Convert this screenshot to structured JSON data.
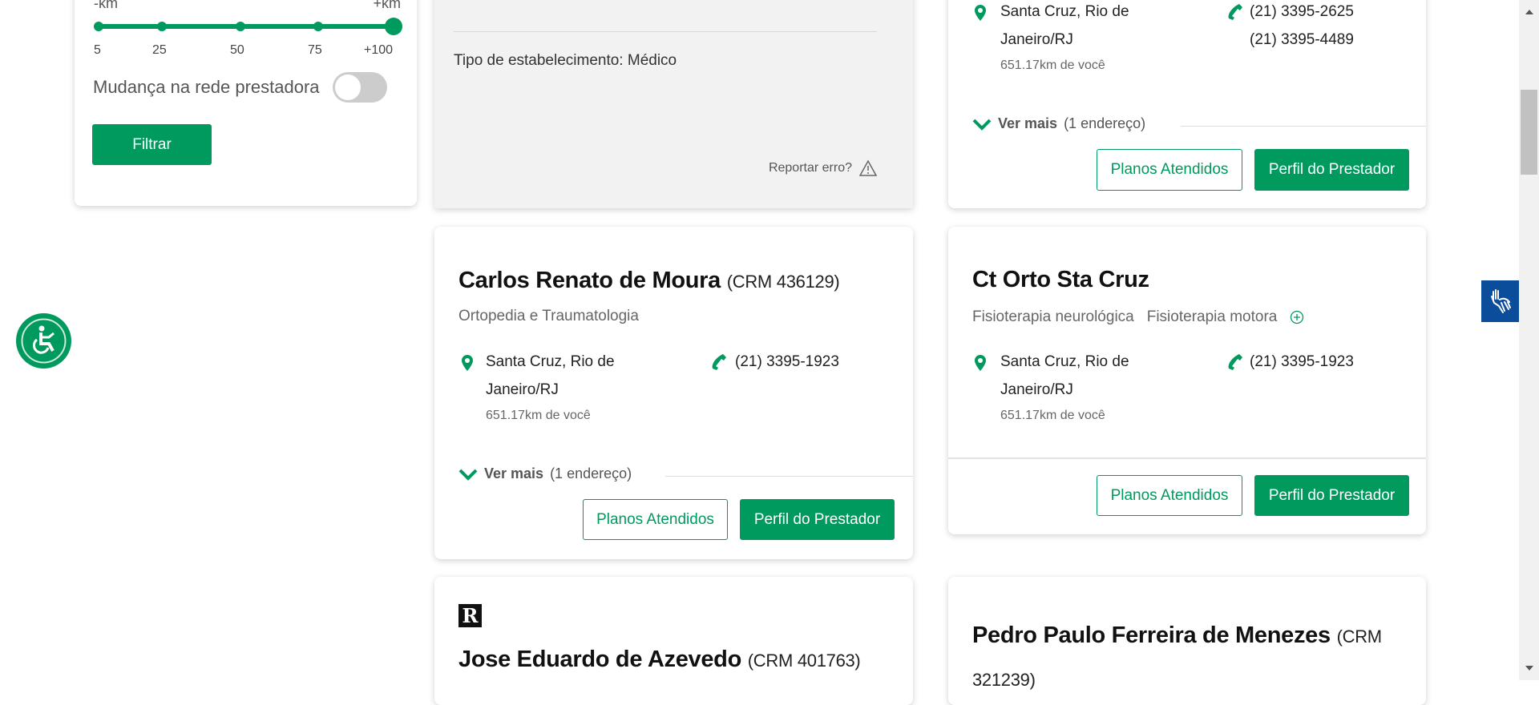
{
  "filter": {
    "min_label": "-km",
    "max_label": "+km",
    "ticks": [
      "5",
      "25",
      "50",
      "75",
      "+100"
    ],
    "selected_tick": "+100",
    "toggle_label": "Mudança na rede prestadora",
    "toggle_on": false,
    "filter_button": "Filtrar"
  },
  "top_left_card": {
    "type_text": "Tipo de estabelecimento: Médico",
    "report": "Reportar erro?"
  },
  "top_right_card": {
    "address_line1": "Santa Cruz, Rio de",
    "address_line2": "Janeiro/RJ",
    "distance": "651.17km de você",
    "phones": [
      "(21) 3395-2625",
      "(21) 3395-4489"
    ],
    "ver_mais": "Ver mais",
    "ver_mais_count": "(1 endereço)"
  },
  "cards": [
    {
      "name": "Carlos Renato de Moura",
      "crm": "(CRM 436129)",
      "specialties": [
        "Ortopedia e Traumatologia"
      ],
      "address_line1": "Santa Cruz, Rio de",
      "address_line2": "Janeiro/RJ",
      "distance": "651.17km de você",
      "phone": "(21) 3395-1923",
      "ver_mais": "Ver mais",
      "ver_mais_count": "(1 endereço)"
    },
    {
      "name": "Ct Orto Sta Cruz",
      "crm": "",
      "specialties": [
        "Fisioterapia neurológica",
        "Fisioterapia motora"
      ],
      "address_line1": "Santa Cruz, Rio de",
      "address_line2": "Janeiro/RJ",
      "distance": "651.17km de você",
      "phone": "(21) 3395-1923"
    },
    {
      "name": "Jose Eduardo de Azevedo",
      "crm": "(CRM 401763)",
      "badge": "R"
    },
    {
      "name": "Pedro Paulo Ferreira de Menezes",
      "crm": "(CRM 321239)"
    }
  ],
  "buttons": {
    "plans": "Planos Atendidos",
    "profile": "Perfil do Prestador"
  },
  "colors": {
    "accent": "#009a5e",
    "libras": "#0b4d9a"
  }
}
